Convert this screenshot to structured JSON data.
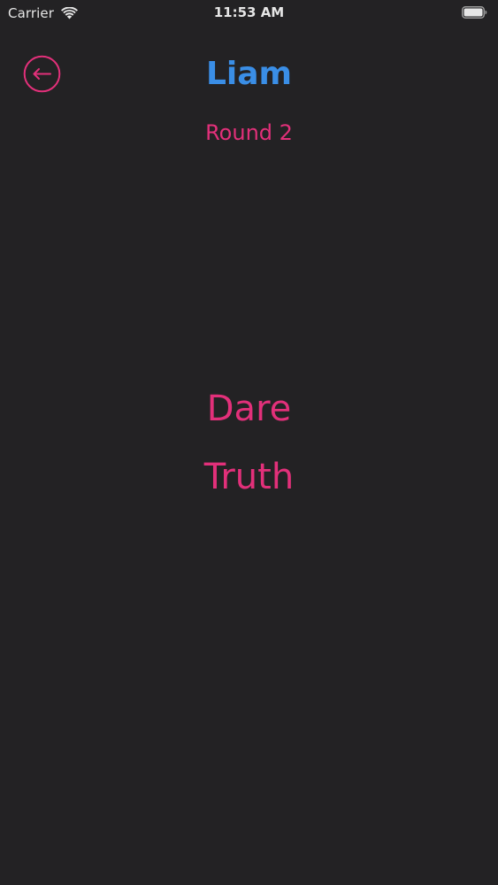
{
  "status_bar": {
    "carrier": "Carrier",
    "time": "11:53 AM",
    "icons": [
      "wifi-icon",
      "battery-icon"
    ]
  },
  "header": {
    "back_icon": "back-arrow-icon",
    "player_name": "Liam",
    "round": "Round 2"
  },
  "choices": {
    "dare": "Dare",
    "truth": "Truth"
  },
  "colors": {
    "background": "#232224",
    "accent_pink": "#e2307a",
    "name_blue": "#3a8ee6",
    "status_text": "#e6e6e6"
  }
}
